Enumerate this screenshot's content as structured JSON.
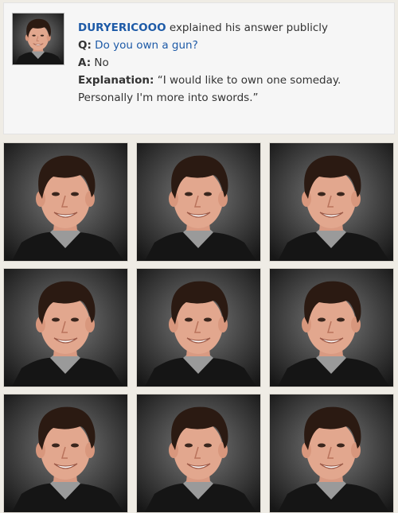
{
  "card": {
    "username": "DURYERICOOO",
    "action": "explained his answer publicly",
    "question_prefix": "Q:",
    "question": "Do you own a gun?",
    "answer_prefix": "A:",
    "answer": "No",
    "explanation_prefix": "Explanation:",
    "explanation_line1": "“I would like to own one someday.",
    "explanation_line2": "Personally I'm more into swords.”"
  },
  "photo_grid": {
    "rows": 3,
    "columns": 3
  },
  "colors": {
    "link": "#1d5aa7",
    "background": "#efece5",
    "card": "#f6f6f6"
  }
}
